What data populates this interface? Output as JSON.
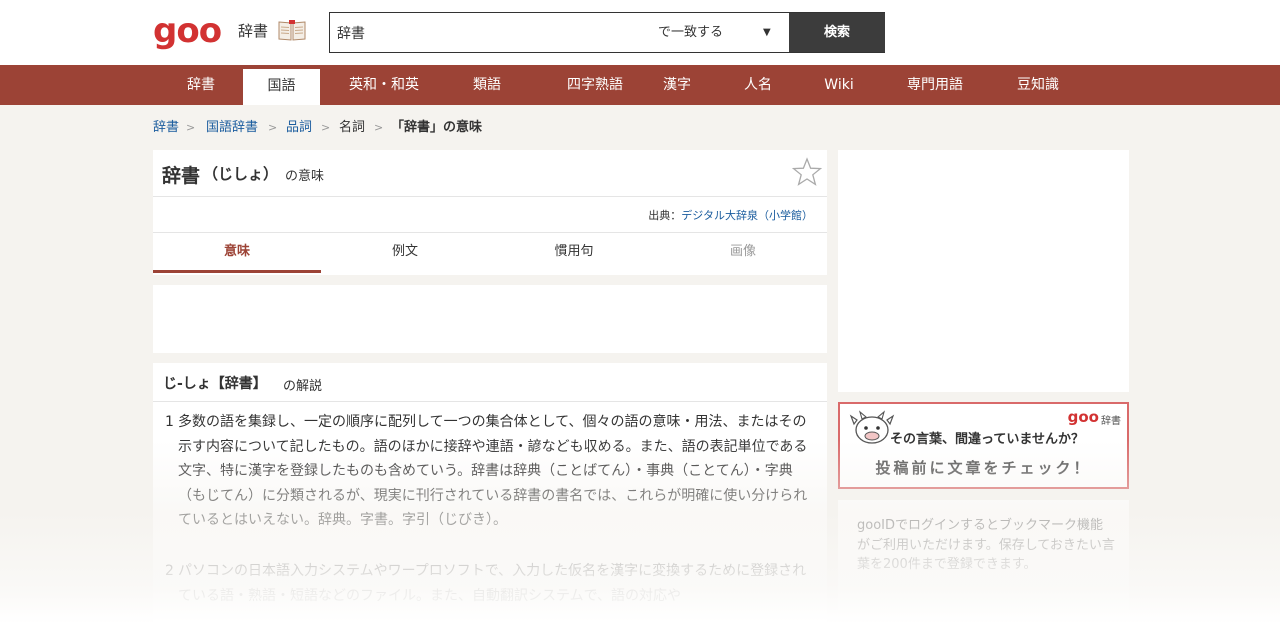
{
  "header": {
    "logo": "goo",
    "site_name": "辞書",
    "search_value": "辞書",
    "match_mode": "で一致する",
    "search_button": "検索"
  },
  "nav": {
    "items": [
      "辞書",
      "国語",
      "英和・和英",
      "類語",
      "四字熟語",
      "漢字",
      "人名",
      "Wiki",
      "専門用語",
      "豆知識"
    ],
    "active": "国語"
  },
  "breadcrumb": {
    "items": [
      "辞書",
      "国語辞書",
      "品詞",
      "名詞"
    ],
    "current": "「辞書」の意味"
  },
  "entry": {
    "word": "辞書",
    "reading": "（じしょ）",
    "suffix": "の意味",
    "source_label": "出典：",
    "source_name": "デジタル大辞泉（小学館）",
    "tabs": [
      "意味",
      "例文",
      "慣用句",
      "画像"
    ],
    "active_tab": "意味"
  },
  "explanation": {
    "heading": "じ-しょ【辞書】",
    "heading_suffix": "の解説",
    "definitions": [
      {
        "num": "1",
        "text": "多数の語を集録し、一定の順序に配列して一つの集合体として、個々の語の意味・用法、またはその示す内容について記したもの。語のほかに接辞や連語・諺なども収める。また、語の表記単位である文字、特に漢字を登録したものも含めていう。辞書は辞典（ことばてん）・事典（ことてん）・字典（もじてん）に分類されるが、現実に刊行されている辞書の書名では、これらが明確に使い分けられているとはいえない。辞典。字書。字引（じびき）。"
      },
      {
        "num": "2",
        "text": "パソコンの日本語入力システムやワープロソフトで、入力した仮名を漢字に変換するために登録されている語・熟語・短語などのファイル。また、自動翻訳システムで、語の対応や"
      }
    ]
  },
  "sidebar": {
    "banner_logo": "goo",
    "banner_logo_sub": "辞書",
    "banner_line1": "その言葉、間違っていませんか？",
    "banner_line2": "投稿前に文章をチェック！",
    "login_text": "gooIDでログインするとブックマーク機能がご利用いただけます。保存しておきたい言葉を200件まで登録できます。"
  },
  "colors": {
    "brand_red": "#d23232",
    "nav_brown": "#9c4336",
    "link_blue": "#1a5c9e"
  }
}
